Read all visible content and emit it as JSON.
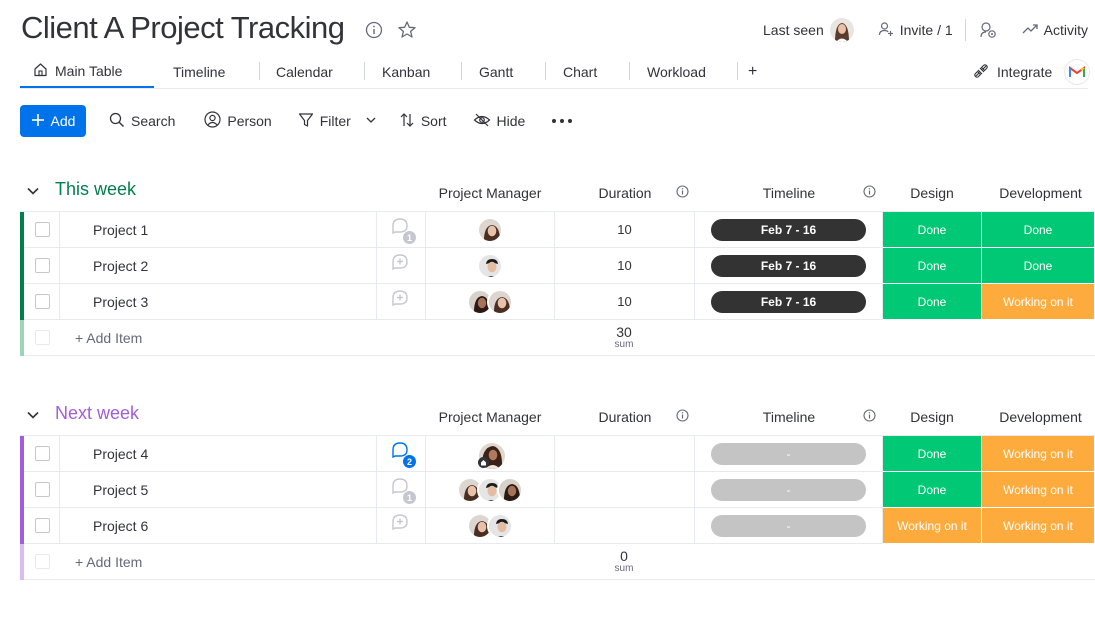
{
  "header": {
    "title": "Client A Project Tracking",
    "last_seen_label": "Last seen",
    "invite_label": "Invite / 1",
    "activity_label": "Activity"
  },
  "tabs": [
    {
      "label": "Main Table",
      "icon": "home-icon",
      "active": true
    },
    {
      "label": "Timeline"
    },
    {
      "label": "Calendar"
    },
    {
      "label": "Kanban"
    },
    {
      "label": "Gantt"
    },
    {
      "label": "Chart"
    },
    {
      "label": "Workload"
    },
    {
      "label": "+"
    }
  ],
  "integrate_label": "Integrate",
  "toolbar": {
    "add_label": "Add",
    "search_label": "Search",
    "person_label": "Person",
    "filter_label": "Filter",
    "sort_label": "Sort",
    "hide_label": "Hide"
  },
  "columns": {
    "pm": "Project Manager",
    "duration": "Duration",
    "timeline": "Timeline",
    "design": "Design",
    "development": "Development"
  },
  "colors": {
    "primary": "#0073ea",
    "done": "#00c875",
    "working": "#fdab3d",
    "group1": "#037f4c",
    "group2": "#a25ddc",
    "timeline_dark": "#333333",
    "timeline_empty": "#c4c4c4"
  },
  "groups": [
    {
      "title": "This week",
      "color": "#037f4c",
      "light_color": "#9bd4b8",
      "rows": [
        {
          "name": "Project 1",
          "updates": "1",
          "duration": "10",
          "timeline": "Feb 7 - 16",
          "design": "Done",
          "development": "Done"
        },
        {
          "name": "Project 2",
          "updates": "",
          "duration": "10",
          "timeline": "Feb 7 - 16",
          "design": "Done",
          "development": "Done"
        },
        {
          "name": "Project 3",
          "updates": "",
          "duration": "10",
          "timeline": "Feb 7 - 16",
          "design": "Done",
          "development": "Working on it"
        }
      ],
      "add_item": "+ Add Item",
      "sum_value": "30",
      "sum_label": "sum"
    },
    {
      "title": "Next week",
      "color": "#a25ddc",
      "light_color": "#d9bdf0",
      "rows": [
        {
          "name": "Project 4",
          "updates": "2",
          "duration": "",
          "timeline": "-",
          "design": "Done",
          "development": "Working on it"
        },
        {
          "name": "Project 5",
          "updates": "1",
          "duration": "",
          "timeline": "-",
          "design": "Done",
          "development": "Working on it"
        },
        {
          "name": "Project 6",
          "updates": "",
          "duration": "",
          "timeline": "-",
          "design": "Working on it",
          "development": "Working on it"
        }
      ],
      "add_item": "+ Add Item",
      "sum_value": "0",
      "sum_label": "sum"
    }
  ]
}
